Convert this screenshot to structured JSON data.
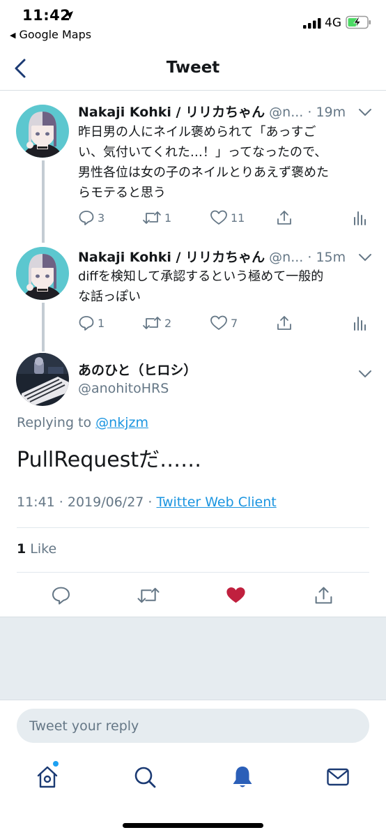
{
  "status_bar": {
    "time": "11:42",
    "back_app": "Google Maps",
    "network": "4G"
  },
  "nav": {
    "title": "Tweet",
    "back_icon": "chevron-left-icon"
  },
  "thread": [
    {
      "name": "Nakaji Kohki / リリカちゃん",
      "handle": "@n...",
      "time": "· 19m",
      "text_lines": [
        "昨日男の人にネイル褒められて「あっすご",
        "い、気付いてくれた…！」ってなったので、",
        "男性各位は女の子のネイルとりあえず褒めた",
        "らモテると思う"
      ],
      "replies": "3",
      "retweets": "1",
      "likes": "11"
    },
    {
      "name": "Nakaji Kohki / リリカちゃん",
      "handle": "@n...",
      "time": "· 15m",
      "text_lines": [
        "diffを検知して承認するという極めて一般的",
        "な話っぽい"
      ],
      "replies": "1",
      "retweets": "2",
      "likes": "7"
    }
  ],
  "main_tweet": {
    "author_name": "あのひと（ヒロシ）",
    "author_handle": "@anohitoHRS",
    "replying_prefix": "Replying to ",
    "replying_mention": "@nkjzm",
    "text": "PullRequestだ……",
    "timestamp": "11:41 · 2019/06/27 · ",
    "client": "Twitter Web Client",
    "like_count": "1",
    "like_label": " Like",
    "liked": true
  },
  "reply": {
    "placeholder": "Tweet your reply"
  },
  "tabbar": {
    "items": [
      "home-icon",
      "search-icon",
      "notifications-icon",
      "messages-icon"
    ],
    "active": "notifications-icon"
  },
  "colors": {
    "accent": "#1da1f2",
    "nav_icon": "#1b3a73",
    "like_red": "#c0203e",
    "secondary_text": "#657786"
  }
}
